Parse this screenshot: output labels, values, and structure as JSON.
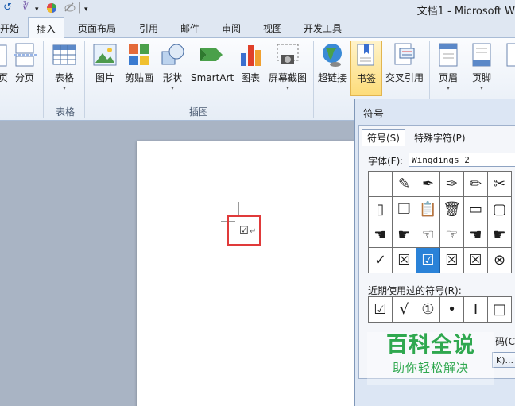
{
  "window": {
    "title": "文档1 - Microsoft W"
  },
  "quick_access": {
    "undo_glyph": "↺",
    "format_glyph": "∛",
    "dropdown_glyph": "▾",
    "sep_glyph": "|"
  },
  "tabs": [
    {
      "label": "开始"
    },
    {
      "label": "插入",
      "active": true
    },
    {
      "label": "页面布局"
    },
    {
      "label": "引用"
    },
    {
      "label": "邮件"
    },
    {
      "label": "审阅"
    },
    {
      "label": "视图"
    },
    {
      "label": "开发工具"
    }
  ],
  "ribbon": {
    "pages": {
      "partial_label": "页",
      "break_label": "分页"
    },
    "table": {
      "label": "表格",
      "group": "表格"
    },
    "illustrations": {
      "group": "插图",
      "picture": "图片",
      "clipart": "剪贴画",
      "shapes": "形状",
      "smartart": "SmartArt",
      "chart": "图表",
      "screenshot": "屏幕截图"
    },
    "links": {
      "hyperlink": "超链接",
      "bookmark": "书签",
      "crossref": "交叉引用"
    },
    "header_footer": {
      "header": "页眉",
      "footer": "页脚"
    },
    "dropdown_arrow": "▾"
  },
  "document": {
    "inserted_symbol": "☑",
    "paragraph_mark": "↵"
  },
  "dialog": {
    "title": "符号",
    "tab_symbols": "符号(S)",
    "tab_special": "特殊字符(P)",
    "font_label": "字体(F):",
    "font_value": "Wingdings 2",
    "grid_rows": [
      [
        "",
        "✎",
        "✒",
        "✑",
        "✏",
        "✂"
      ],
      [
        "▯",
        "❐",
        "📋",
        "🗑",
        "▭",
        "▢"
      ],
      [
        "☚",
        "☛",
        "☜",
        "☞",
        "☚",
        "☛"
      ],
      [
        "✓",
        "☒",
        "☑",
        "☒",
        "☒",
        "⊗"
      ]
    ],
    "selected_cell": [
      3,
      2
    ],
    "recent_label": "近期使用过的符号(R):",
    "recent_symbols": [
      "☑",
      "√",
      "①",
      "•",
      "I",
      "□"
    ],
    "code_label": "码(C",
    "shortcut_btn": "K)..."
  },
  "watermark": {
    "line1": "百科全说",
    "line2": "助你轻松解决"
  },
  "colors": {
    "accent_blue": "#2a82d8",
    "highlight_red": "#e03a3a",
    "watermark_green": "#2fa84f"
  }
}
